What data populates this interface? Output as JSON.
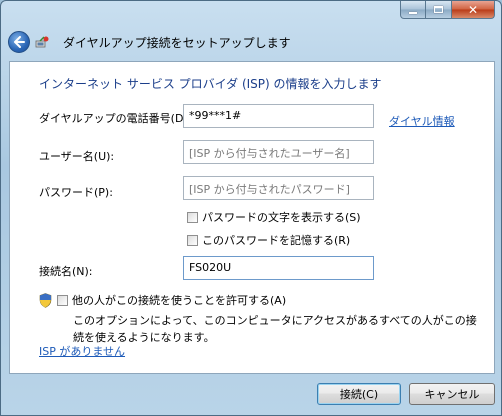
{
  "window": {
    "title": "ダイヤルアップ接続をセットアップします",
    "back_icon": "back-arrow-icon",
    "app_icon": "dialup-connection-icon",
    "minimize_icon": "minimize-icon",
    "maximize_icon": "maximize-icon",
    "close_icon": "close-icon",
    "close_glyph": "✕"
  },
  "instruction": "インターネット サービス プロバイダ (ISP) の情報を入力します",
  "form": {
    "phone": {
      "label": "ダイヤルアップの電話番号(D):",
      "value": "*99***1#"
    },
    "dialing_rules_link": "ダイヤル情報",
    "username": {
      "label": "ユーザー名(U):",
      "placeholder": "[ISP から付与されたユーザー名]"
    },
    "password": {
      "label": "パスワード(P):",
      "placeholder": "[ISP から付与されたパスワード]"
    },
    "show_chars": {
      "label": "パスワードの文字を表示する(S)",
      "checked": false
    },
    "remember_password": {
      "label": "このパスワードを記憶する(R)",
      "checked": false
    },
    "connection_name": {
      "label": "接続名(N):",
      "value": "FS020U"
    },
    "allow_others": {
      "label": "他の人がこの接続を使うことを許可する(A)",
      "checked": false
    },
    "allow_others_description": "このオプションによって、このコンピュータにアクセスがあるすべての人がこの接続を使えるようになります。",
    "no_isp_link": "ISP がありません"
  },
  "buttons": {
    "connect": "接続(C)",
    "cancel": "キャンセル"
  },
  "colors": {
    "instruction": "#1b3e8a",
    "link": "#1d5ab8",
    "frame": "#a9c8e0"
  }
}
